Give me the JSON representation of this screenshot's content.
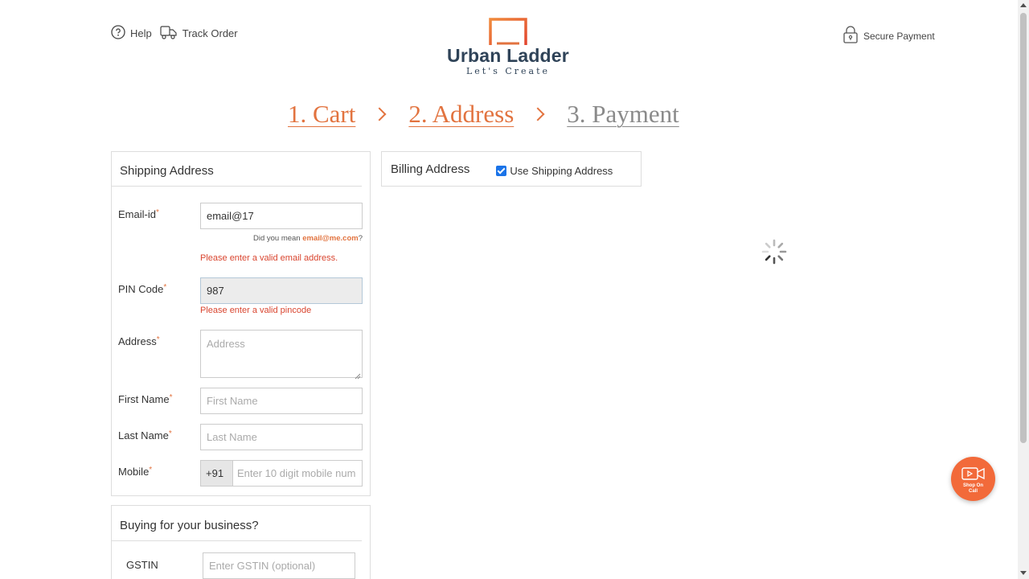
{
  "header": {
    "help_label": "Help",
    "track_label": "Track Order",
    "secure_label": "Secure Payment",
    "help_icon": "question-circle-icon",
    "track_icon": "delivery-truck-icon",
    "secure_icon": "padlock-icon"
  },
  "brand": {
    "name": "Urban Ladder",
    "tagline": "Let's Create",
    "color_primary": "#2f4358",
    "color_accent": "#e2733f"
  },
  "steps": [
    {
      "label": "1. Cart",
      "state": "done"
    },
    {
      "label": "2. Address",
      "state": "current"
    },
    {
      "label": "3. Payment",
      "state": "pending"
    }
  ],
  "shipping": {
    "title": "Shipping Address",
    "email_label": "Email-id",
    "email_value": "email@17",
    "email_hint_prefix": "Did you mean",
    "email_hint_suggestion": "email@me.com",
    "email_hint_suffix": "?",
    "email_error": "Please enter a valid email address.",
    "pin_label": "PIN Code",
    "pin_value": "987",
    "pin_error": "Please enter a valid pincode",
    "address_label": "Address",
    "address_placeholder": "Address",
    "first_label": "First Name",
    "first_placeholder": "First Name",
    "last_label": "Last Name",
    "last_placeholder": "Last Name",
    "mobile_label": "Mobile",
    "mobile_prefix": "+91",
    "mobile_placeholder": "Enter 10 digit mobile num",
    "required_mark": "*"
  },
  "business": {
    "title": "Buying for your business?",
    "gstin_label": "GSTIN",
    "gstin_placeholder": "Enter GSTIN (optional)"
  },
  "billing": {
    "title": "Billing Address",
    "use_shipping_label": "Use Shipping Address",
    "use_shipping_checked": true
  },
  "fab": {
    "label_line1": "Shop On",
    "label_line2": "Call",
    "icon": "video-camera-icon",
    "color": "#f26a3a"
  },
  "error_color": "#d9452f"
}
